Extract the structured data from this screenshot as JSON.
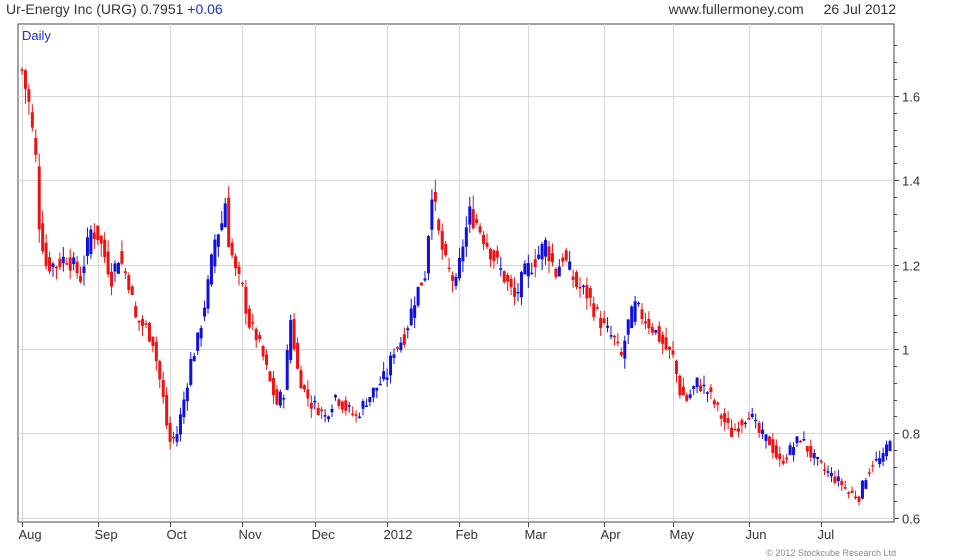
{
  "header": {
    "instrument": "Ur-Energy Inc (URG)",
    "last": "0.7951",
    "change": "+0.06",
    "site": "www.fullermoney.com",
    "date": "26 Jul 2012"
  },
  "footer": {
    "copyright": "© 2012 Stockcube Research Ltd"
  },
  "chart_data": {
    "type": "candlestick",
    "period_label": "Daily",
    "y_axis": {
      "side": "right",
      "ylim": [
        0.59,
        1.77
      ],
      "ticks": [
        0.6,
        0.8,
        1,
        1.2,
        1.4,
        1.6
      ]
    },
    "x_axis": {
      "labels": [
        {
          "label": "Aug",
          "day": 0
        },
        {
          "label": "Sep",
          "day": 22
        },
        {
          "label": "Oct",
          "day": 43
        },
        {
          "label": "Nov",
          "day": 64
        },
        {
          "label": "Dec",
          "day": 85
        },
        {
          "label": "2012",
          "day": 106
        },
        {
          "label": "Feb",
          "day": 127
        },
        {
          "label": "Mar",
          "day": 147
        },
        {
          "label": "Apr",
          "day": 169
        },
        {
          "label": "May",
          "day": 189
        },
        {
          "label": "Jun",
          "day": 211
        },
        {
          "label": "Jul",
          "day": 232
        }
      ],
      "total_days": 253
    },
    "grid": true,
    "colors": {
      "up": "#1010dd",
      "down": "#ee1111",
      "grid": "#d8d8d8",
      "axis": "#444444"
    },
    "close_anchors": [
      [
        0,
        1.66
      ],
      [
        2,
        1.58
      ],
      [
        4,
        1.45
      ],
      [
        5,
        1.3
      ],
      [
        7,
        1.2
      ],
      [
        10,
        1.2
      ],
      [
        13,
        1.22
      ],
      [
        17,
        1.17
      ],
      [
        20,
        1.28
      ],
      [
        22,
        1.27
      ],
      [
        26,
        1.17
      ],
      [
        28,
        1.22
      ],
      [
        31,
        1.16
      ],
      [
        33,
        1.07
      ],
      [
        36,
        1.05
      ],
      [
        38,
        1.02
      ],
      [
        41,
        0.88
      ],
      [
        42,
        0.82
      ],
      [
        43,
        0.78
      ],
      [
        45,
        0.8
      ],
      [
        47,
        0.88
      ],
      [
        49,
        0.97
      ],
      [
        51,
        1.02
      ],
      [
        54,
        1.15
      ],
      [
        56,
        1.26
      ],
      [
        58,
        1.3
      ],
      [
        59,
        1.35
      ],
      [
        60,
        1.26
      ],
      [
        62,
        1.18
      ],
      [
        64,
        1.14
      ],
      [
        66,
        1.06
      ],
      [
        68,
        1.03
      ],
      [
        70,
        0.98
      ],
      [
        72,
        0.92
      ],
      [
        74,
        0.87
      ],
      [
        76,
        0.9
      ],
      [
        78,
        1.07
      ],
      [
        80,
        0.95
      ],
      [
        82,
        0.9
      ],
      [
        84,
        0.87
      ],
      [
        86,
        0.86
      ],
      [
        88,
        0.84
      ],
      [
        91,
        0.89
      ],
      [
        94,
        0.86
      ],
      [
        97,
        0.84
      ],
      [
        100,
        0.88
      ],
      [
        103,
        0.91
      ],
      [
        106,
        0.94
      ],
      [
        108,
        1.0
      ],
      [
        111,
        1.03
      ],
      [
        114,
        1.12
      ],
      [
        117,
        1.18
      ],
      [
        119,
        1.38
      ],
      [
        121,
        1.27
      ],
      [
        123,
        1.2
      ],
      [
        126,
        1.15
      ],
      [
        128,
        1.25
      ],
      [
        130,
        1.32
      ],
      [
        132,
        1.3
      ],
      [
        135,
        1.25
      ],
      [
        138,
        1.2
      ],
      [
        140,
        1.17
      ],
      [
        143,
        1.12
      ],
      [
        146,
        1.18
      ],
      [
        148,
        1.2
      ],
      [
        152,
        1.25
      ],
      [
        155,
        1.18
      ],
      [
        157,
        1.22
      ],
      [
        161,
        1.15
      ],
      [
        164,
        1.13
      ],
      [
        167,
        1.08
      ],
      [
        169,
        1.05
      ],
      [
        172,
        1.02
      ],
      [
        174,
        0.98
      ],
      [
        176,
        1.06
      ],
      [
        178,
        1.1
      ],
      [
        181,
        1.07
      ],
      [
        184,
        1.04
      ],
      [
        187,
        1.0
      ],
      [
        189,
        0.98
      ],
      [
        191,
        0.9
      ],
      [
        193,
        0.88
      ],
      [
        196,
        0.92
      ],
      [
        199,
        0.9
      ],
      [
        203,
        0.84
      ],
      [
        206,
        0.8
      ],
      [
        208,
        0.82
      ],
      [
        211,
        0.85
      ],
      [
        214,
        0.8
      ],
      [
        217,
        0.78
      ],
      [
        220,
        0.73
      ],
      [
        223,
        0.76
      ],
      [
        226,
        0.79
      ],
      [
        229,
        0.75
      ],
      [
        232,
        0.72
      ],
      [
        235,
        0.7
      ],
      [
        238,
        0.68
      ],
      [
        240,
        0.66
      ],
      [
        243,
        0.65
      ],
      [
        245,
        0.7
      ],
      [
        247,
        0.73
      ],
      [
        250,
        0.74
      ],
      [
        252,
        0.7951
      ]
    ]
  }
}
